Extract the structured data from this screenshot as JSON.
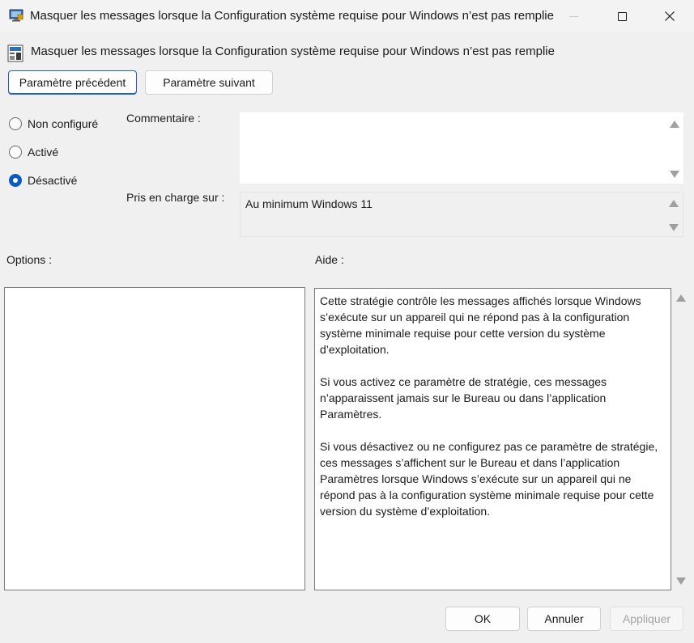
{
  "window": {
    "title": "Masquer les messages lorsque la Configuration système requise pour Windows n’est pas remplie"
  },
  "header": {
    "title": "Masquer les messages lorsque la Configuration système requise pour Windows n’est pas remplie"
  },
  "nav": {
    "previous": "Paramètre précédent",
    "next": "Paramètre suivant"
  },
  "state": {
    "options": [
      {
        "label": "Non configuré",
        "checked": false
      },
      {
        "label": "Activé",
        "checked": false
      },
      {
        "label": "Désactivé",
        "checked": true
      }
    ]
  },
  "comment": {
    "label": "Commentaire :",
    "value": ""
  },
  "supported": {
    "label": "Pris en charge sur :",
    "value": "Au minimum Windows 11"
  },
  "options_panel": {
    "label": "Options :"
  },
  "help": {
    "label": "Aide :",
    "paragraphs": [
      "Cette stratégie contrôle les messages affichés lorsque Windows s’exécute sur un appareil qui ne répond pas à la configuration système minimale requise pour cette version du système d’exploitation.",
      "Si vous activez ce paramètre de stratégie, ces messages n’apparaissent jamais sur le Bureau ou dans l’application Paramètres.",
      "Si vous désactivez ou ne configurez pas ce paramètre de stratégie, ces messages s’affichent sur le Bureau et dans l’application Paramètres lorsque Windows s’exécute sur un appareil qui ne répond pas à la configuration système minimale requise pour cette version du système d’exploitation."
    ]
  },
  "footer": {
    "ok": "OK",
    "cancel": "Annuler",
    "apply": "Appliquer"
  },
  "colors": {
    "accent": "#0a5ac2",
    "window_bg": "#f0f0f0"
  }
}
